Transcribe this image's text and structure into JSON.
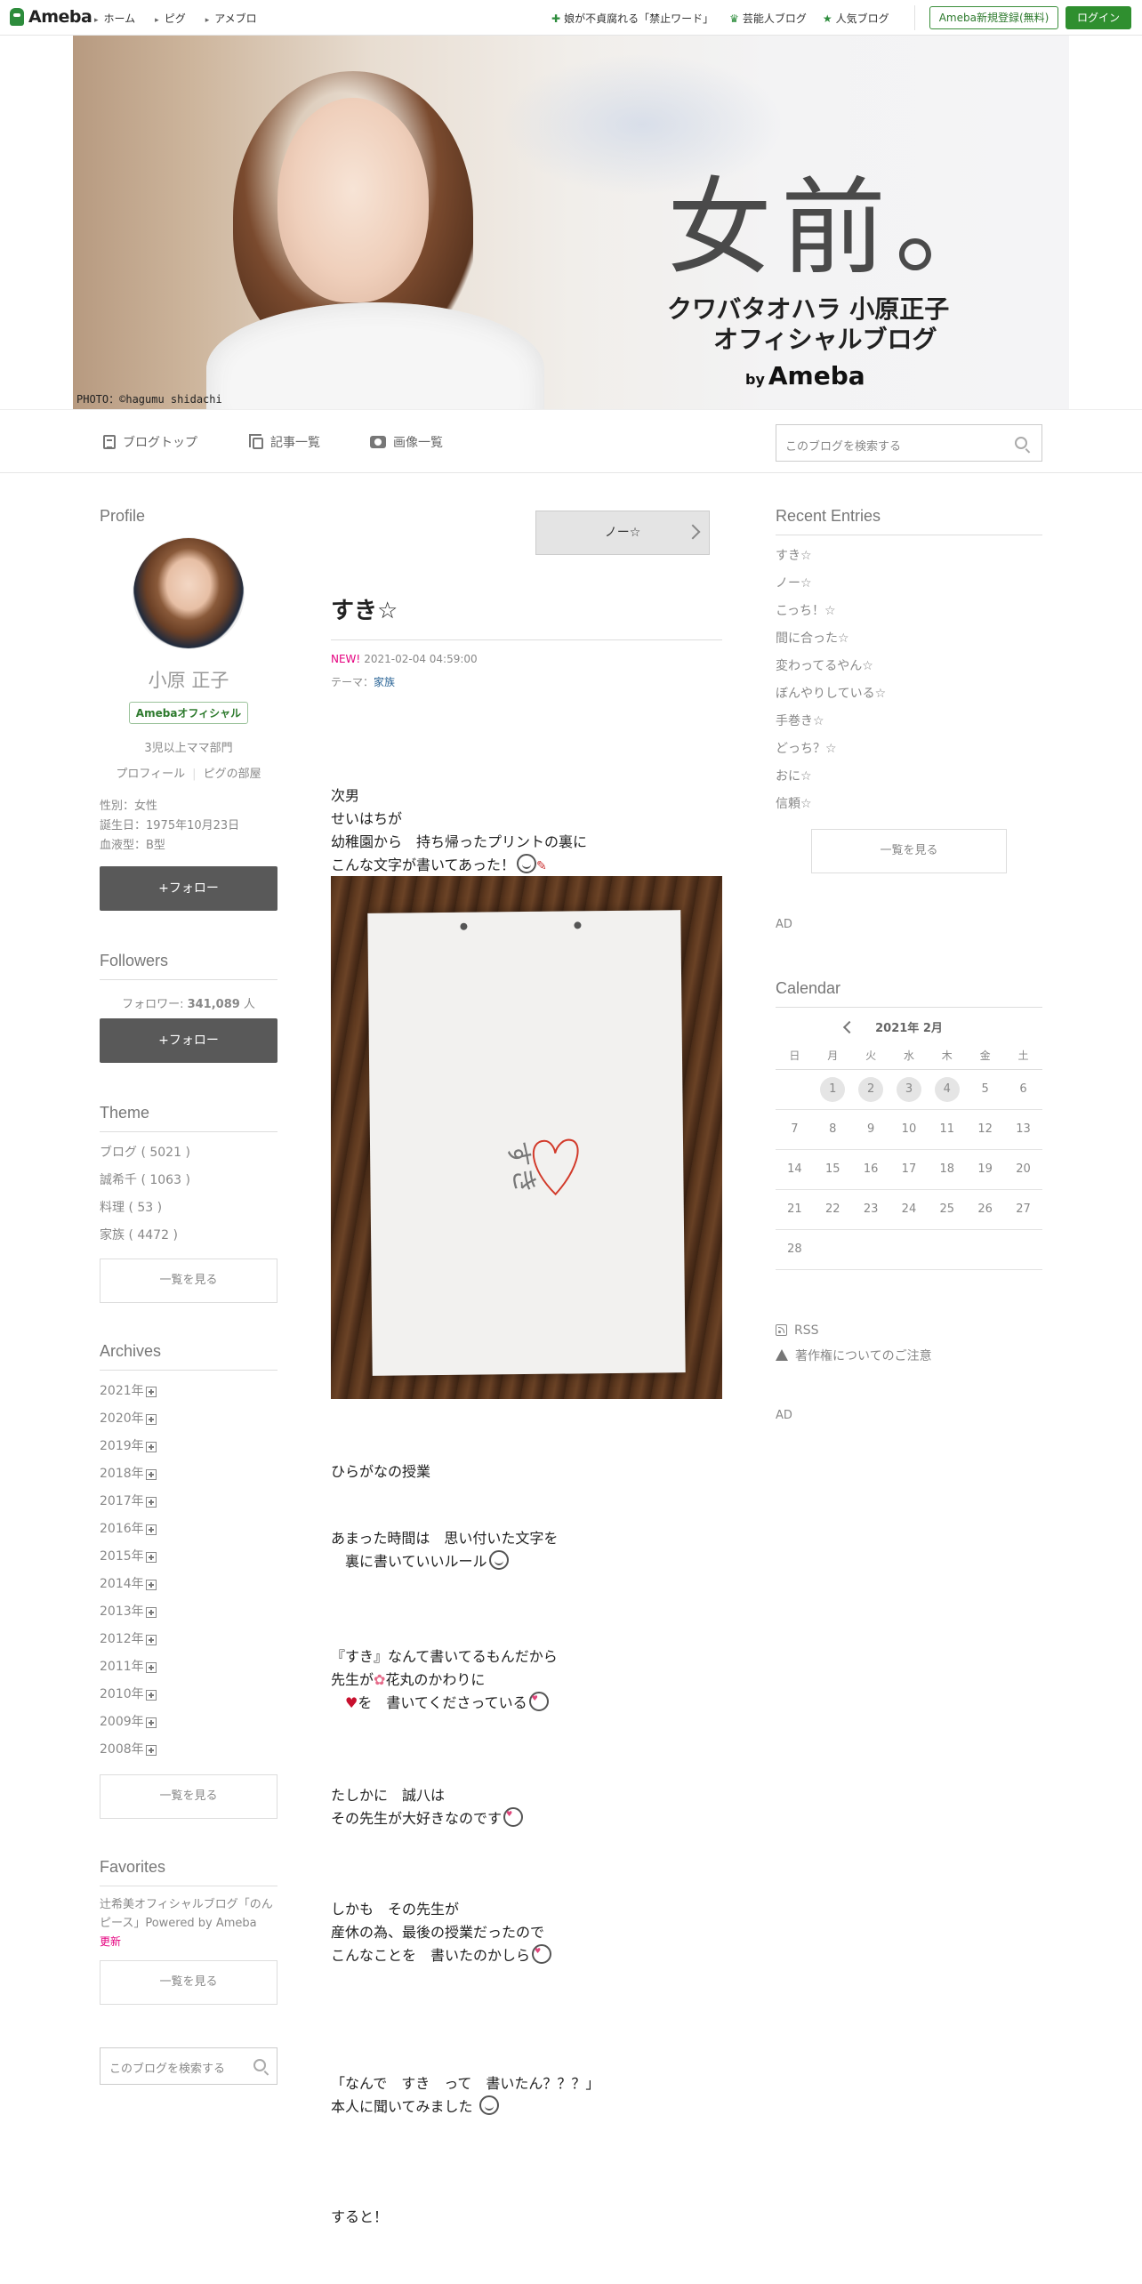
{
  "topbar": {
    "logo": "Ameba",
    "nav": [
      "ホーム",
      "ピグ",
      "アメブロ"
    ],
    "links": [
      "娘が不貞腐れる「禁止ワード」",
      "芸能人ブログ",
      "人気ブログ"
    ],
    "register": "Ameba新規登録(無料)",
    "login": "ログイン"
  },
  "hero": {
    "title": "女前。",
    "sub1": "クワバタオハラ 小原正子",
    "sub2": "オフィシャルブログ",
    "by": "by",
    "brand": "Ameba",
    "credit": "PHOTO：©hagumu shidachi"
  },
  "blognav": {
    "items": [
      "ブログトップ",
      "記事一覧",
      "画像一覧"
    ],
    "search_placeholder": "このブログを検索する"
  },
  "profile": {
    "heading": "Profile",
    "name": "小原 正子",
    "badge": "Amebaオフィシャル",
    "desc": "3児以上ママ部門",
    "link_profile": "プロフィール",
    "link_pig": "ピグの部屋",
    "gender": "性別：女性",
    "birthday": "誕生日：1975年10月23日",
    "blood": "血液型：B型",
    "follow": "+フォロー"
  },
  "followers": {
    "heading": "Followers",
    "label": "フォロワー: ",
    "count": "341,089",
    "unit": " 人",
    "follow": "+フォロー"
  },
  "theme": {
    "heading": "Theme",
    "items": [
      "ブログ ( 5021 )",
      "誠希千 ( 1063 )",
      "料理 ( 53 )",
      "家族 ( 4472 )"
    ],
    "more": "一覧を見る"
  },
  "archives": {
    "heading": "Archives",
    "items": [
      "2021年",
      "2020年",
      "2019年",
      "2018年",
      "2017年",
      "2016年",
      "2015年",
      "2014年",
      "2013年",
      "2012年",
      "2011年",
      "2010年",
      "2009年",
      "2008年"
    ],
    "more": "一覧を見る"
  },
  "favorites": {
    "heading": "Favorites",
    "item": "辻希美オフィシャルブログ「のんピース」Powered by Ameba",
    "updated": "更新",
    "more": "一覧を見る",
    "search_placeholder": "このブログを検索する"
  },
  "entry": {
    "next": "ノー☆",
    "title": "すき☆",
    "new": "NEW!",
    "date": "2021-02-04 04:59:00",
    "theme_label": "テーマ：",
    "theme": "家族",
    "p1": "次男\nせいはちが\n幼稚園から　持ち帰ったプリントの裏に\nこんな文字が書いてあった！",
    "p2": "ひらがなの授業",
    "p3a": "あまった時間は　思い付いた文字を",
    "p3b": "　裏に書いていいルール",
    "p4a": "『すき』なんて書いてるもんだから",
    "p4b": "先生が",
    "p4c": "花丸のかわりに",
    "p4d": "を　書いてくださっている",
    "p5a": "たしかに　誠八は",
    "p5b": "その先生が大好きなのです",
    "p6a": "しかも　その先生が",
    "p6b": "産休の為、最後の授業だったので",
    "p6c": "こんなことを　書いたのかしら",
    "p7a": "「なんで　すき　って　書いたん？？？」",
    "p7b": "本人に聞いてみました",
    "p8": "すると！",
    "drawing_text": "すき"
  },
  "recent": {
    "heading": "Recent Entries",
    "items": [
      "すき☆",
      "ノー☆",
      "こっち！☆",
      "間に合った☆",
      "変わってるやん☆",
      "ぼんやりしている☆",
      "手巻き☆",
      "どっち？☆",
      "おに☆",
      "信頼☆"
    ],
    "more": "一覧を見る"
  },
  "ad1": "AD",
  "calendar": {
    "heading": "Calendar",
    "month": "2021年 2月",
    "weekdays": [
      "日",
      "月",
      "火",
      "水",
      "木",
      "金",
      "土"
    ],
    "weeks": [
      [
        "",
        "1",
        "2",
        "3",
        "4",
        "5",
        "6"
      ],
      [
        "7",
        "8",
        "9",
        "10",
        "11",
        "12",
        "13"
      ],
      [
        "14",
        "15",
        "16",
        "17",
        "18",
        "19",
        "20"
      ],
      [
        "21",
        "22",
        "23",
        "24",
        "25",
        "26",
        "27"
      ],
      [
        "28",
        "",
        "",
        "",
        "",
        "",
        ""
      ]
    ],
    "with_posts": [
      "1",
      "2",
      "3",
      "4"
    ]
  },
  "footer_links": {
    "rss": "RSS",
    "copyright": "著作権についてのご注意"
  },
  "ad2": "AD"
}
